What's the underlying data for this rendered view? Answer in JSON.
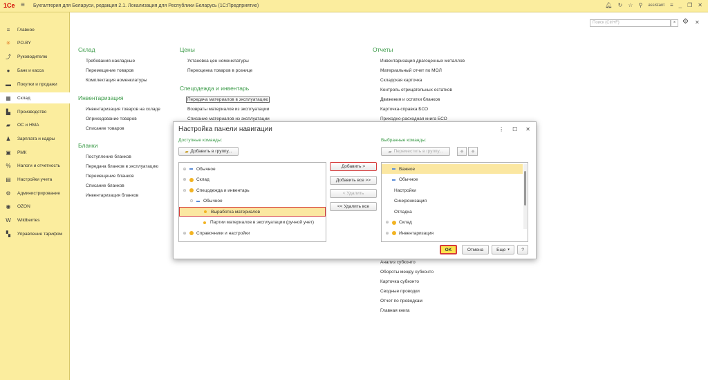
{
  "titlebar": {
    "logo": "1Сe",
    "title": "Бухгалтерия для Беларуси, редакция 2.1. Локализация для Республики Беларусь   (1С:Предприятие)",
    "user": "assistant"
  },
  "sidebar": {
    "items": [
      {
        "label": "Главное",
        "icon": "≡",
        "name": "menu-icon"
      },
      {
        "label": "PO.BY",
        "icon": "✳",
        "name": "po-icon"
      },
      {
        "label": "Руководителю",
        "icon": "⤴",
        "name": "chart-icon"
      },
      {
        "label": "Банк и касса",
        "icon": "●",
        "name": "bank-icon"
      },
      {
        "label": "Покупки и продажи",
        "icon": "▬",
        "name": "cart-icon"
      },
      {
        "label": "Склад",
        "icon": "▦",
        "name": "warehouse-icon"
      },
      {
        "label": "Производство",
        "icon": "▙",
        "name": "factory-icon"
      },
      {
        "label": "ОС и НМА",
        "icon": "▰",
        "name": "truck-icon"
      },
      {
        "label": "Зарплата и кадры",
        "icon": "♟",
        "name": "person-icon"
      },
      {
        "label": "РМК",
        "icon": "▣",
        "name": "pos-icon"
      },
      {
        "label": "Налоги и отчетность",
        "icon": "%",
        "name": "percent-icon"
      },
      {
        "label": "Настройки учета",
        "icon": "▤",
        "name": "book-icon"
      },
      {
        "label": "Администрирование",
        "icon": "⚙",
        "name": "gear-icon"
      },
      {
        "label": "OZON",
        "icon": "◉",
        "name": "ozon-icon"
      },
      {
        "label": "Wildberries",
        "icon": "W",
        "name": "wildberries-icon"
      },
      {
        "label": "Управление тарифом",
        "icon": "▚",
        "name": "tariff-icon"
      }
    ]
  },
  "search": {
    "placeholder": "Поиск (Ctrl+F)"
  },
  "content": {
    "sklad": {
      "title": "Склад",
      "items": [
        "Требования-накладные",
        "Перемещение товаров",
        "Комплектация номенклатуры"
      ]
    },
    "inventar": {
      "title": "Инвентаризация",
      "items": [
        "Инвентаризация товаров на складе",
        "Оприходование товаров",
        "Списание товаров"
      ]
    },
    "blanki": {
      "title": "Бланки",
      "items": [
        "Поступление бланков",
        "Передача бланков в эксплуатацию",
        "Перемещение бланков",
        "Списание бланков",
        "Инвентаризация бланков"
      ]
    },
    "ceny": {
      "title": "Цены",
      "items": [
        "Установка цен номенклатуры",
        "Переоценка товаров в рознице"
      ]
    },
    "specodezhda": {
      "title": "Спецодежда и инвентарь",
      "items": [
        "Передача материалов в эксплуатацию",
        "Возвраты материалов из эксплуатации",
        "Списание материалов из эксплуатации"
      ]
    },
    "otchety": {
      "title": "Отчеты",
      "items": [
        "Инвентаризация драгоценных металлов",
        "Материальный отчет по МОЛ",
        "Складская карточка",
        "Контроль отрицательных остатков",
        "Движения и остатки бланков",
        "Карточка-справка БСО",
        "Приходно-расходная книга БСО"
      ],
      "items_below": [
        "Анализ субконто",
        "Обороты между субконто",
        "Карточка субконто",
        "Сводные проводки",
        "Отчет по проводкам",
        "Главная книга"
      ]
    }
  },
  "dialog": {
    "title": "Настройка панели навигации",
    "available_label": "Доступные команды:",
    "selected_label": "Выбранные команды:",
    "add_to_group": "Добавить в группу...",
    "move_to_group": "Переместить в группу...",
    "add": "Добавить >",
    "add_all": "Добавить все >>",
    "remove": "< Удалить",
    "remove_all": "<< Удалить все",
    "ok": "OK",
    "cancel": "Отмена",
    "more": "Еще",
    "help": "?",
    "available": [
      {
        "label": "Обычное",
        "kind": "dash",
        "lvl": 0,
        "exp": "⊕"
      },
      {
        "label": "Склад",
        "kind": "dot",
        "lvl": 0,
        "exp": "⊕"
      },
      {
        "label": "Спецодежда и инвентарь",
        "kind": "dot",
        "lvl": 0,
        "exp": "⊖"
      },
      {
        "label": "Обычное",
        "kind": "dash",
        "lvl": 1,
        "exp": "⊖"
      },
      {
        "label": "Выработка материалов",
        "kind": "dots",
        "lvl": 2,
        "exp": ""
      },
      {
        "label": "Партии материалов в эксплуатации (ручной учет)",
        "kind": "dots",
        "lvl": 2,
        "exp": ""
      },
      {
        "label": "Справочники и настройки",
        "kind": "dot",
        "lvl": 0,
        "exp": "⊕"
      }
    ],
    "selected": [
      {
        "label": "Важное",
        "kind": "dash",
        "lvl": 0,
        "exp": ""
      },
      {
        "label": "Обычное",
        "kind": "dash",
        "lvl": 0,
        "exp": ""
      },
      {
        "label": "Настройки",
        "kind": "none",
        "lvl": 0,
        "exp": ""
      },
      {
        "label": "Синхронизация",
        "kind": "none",
        "lvl": 0,
        "exp": ""
      },
      {
        "label": "Отладка",
        "kind": "none",
        "lvl": 0,
        "exp": ""
      },
      {
        "label": "Склад",
        "kind": "dot",
        "lvl": 0,
        "exp": "⊕"
      },
      {
        "label": "Инвентаризация",
        "kind": "dot",
        "lvl": 0,
        "exp": "⊕"
      }
    ]
  }
}
